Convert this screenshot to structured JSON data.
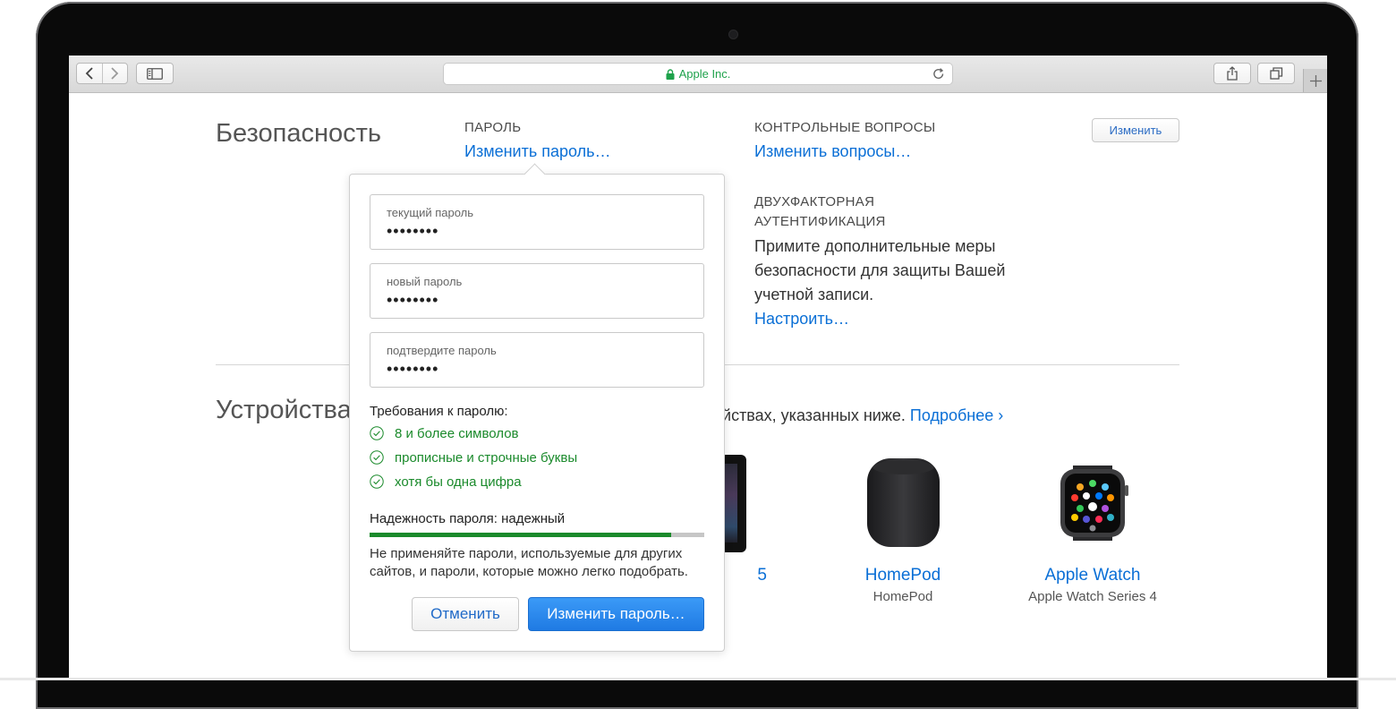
{
  "browser": {
    "address": "Apple Inc."
  },
  "security": {
    "heading": "Безопасность",
    "password_label": "ПАРОЛЬ",
    "password_link": "Изменить пароль…",
    "questions_label": "КОНТРОЛЬНЫЕ ВОПРОСЫ",
    "questions_link": "Изменить вопросы…",
    "edit_button": "Изменить",
    "twofa_label_1": "ДВУХФАКТОРНАЯ",
    "twofa_label_2": "АУТЕНТИФИКАЦИЯ",
    "twofa_text_1": "Примите дополнительные меры",
    "twofa_text_2": "безопасности для защиты Вашей",
    "twofa_text_3": "учетной записи.",
    "twofa_link": "Настроить…"
  },
  "devices": {
    "heading": "Устройства",
    "intro_text": "ойствах, указанных ниже.",
    "intro_link": "Подробнее ›",
    "partial_device_name": "5",
    "items": [
      {
        "name": "HomePod",
        "model": "HomePod"
      },
      {
        "name": "Apple Watch",
        "model": "Apple Watch Series 4"
      }
    ]
  },
  "popover": {
    "fields": [
      {
        "placeholder": "текущий пароль",
        "value": "••••••••"
      },
      {
        "placeholder": "новый пароль",
        "value": "••••••••"
      },
      {
        "placeholder": "подтвердите пароль",
        "value": "••••••••"
      }
    ],
    "requirements_title": "Требования к паролю:",
    "requirements": [
      "8 и более символов",
      "прописные и строчные буквы",
      "хотя бы одна цифра"
    ],
    "strength_label": "Надежность пароля: надежный",
    "strength_fraction": 0.9,
    "note": "Не применяйте пароли, используемые для других сайтов, и пароли, которые можно легко подобрать.",
    "cancel_button": "Отменить",
    "submit_button": "Изменить пароль…"
  },
  "colors": {
    "link": "#0a6fd6",
    "success": "#1a8a2b",
    "primary_button": "#1f7ae3"
  }
}
